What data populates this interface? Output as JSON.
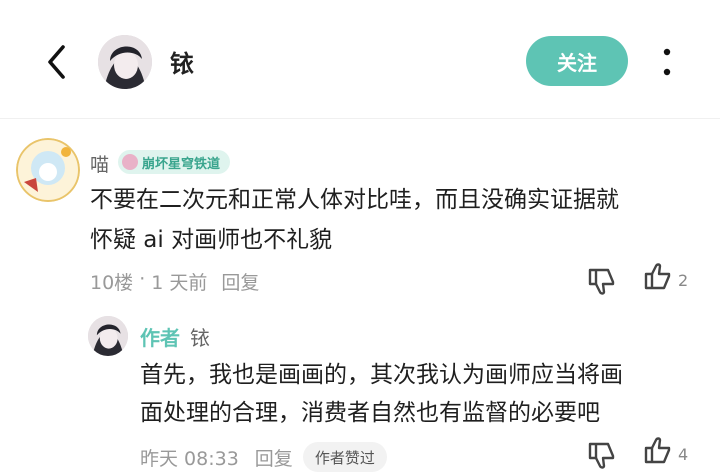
{
  "header": {
    "username": "铱",
    "follow_label": "关注"
  },
  "comment": {
    "username": "喵",
    "game_badge": "崩坏星穹铁道",
    "text_line1": "不要在二次元和正常人体对比哇，而且没确实证据就",
    "text_line2": "怀疑 ai 对画师也不礼貌",
    "floor": "10楼",
    "separator": "·",
    "time": "1 天前",
    "reply_label": "回复",
    "like_count": "2"
  },
  "reply": {
    "author_tag": "作者",
    "username": "铱",
    "text_line1": "首先，我也是画画的，其次我认为画师应当将画",
    "text_line2": "面处理的合理，消费者自然也有监督的必要吧",
    "time": "昨天 08:33",
    "reply_label": "回复",
    "praise_badge": "作者赞过",
    "like_count": "4"
  },
  "colors": {
    "accent": "#5ec4b4",
    "text_primary": "#1f1f1f",
    "text_muted": "#999999"
  }
}
